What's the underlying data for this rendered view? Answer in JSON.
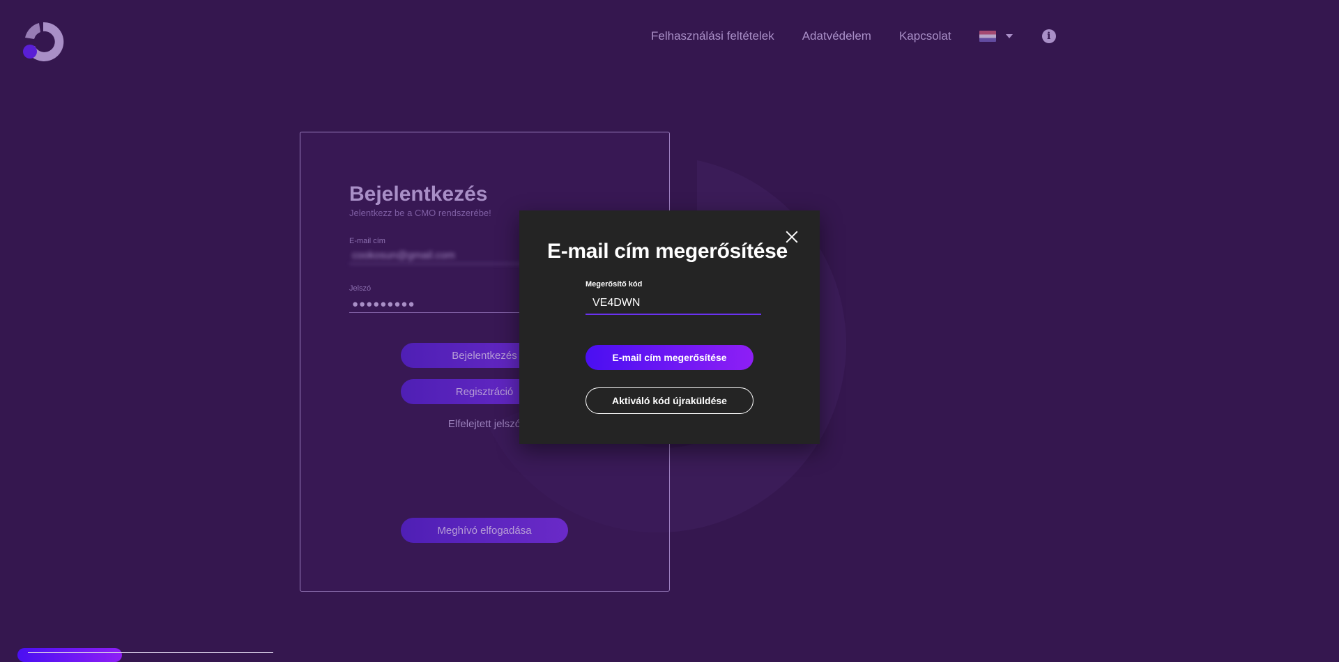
{
  "nav": {
    "links": [
      "Felhasználási feltételek",
      "Adatvédelem",
      "Kapcsolat"
    ],
    "language_icon": "hungarian-flag-icon",
    "info_icon": "info-icon",
    "info_glyph": "i"
  },
  "login": {
    "title": "Bejelentkezés",
    "subtitle": "Jelentkezz be a CMO rendszerébe!",
    "email_label": "E-mail cím",
    "email_value": "cookosun@gmail.com",
    "password_label": "Jelszó",
    "password_value": "●●●●●●●●●",
    "login_button": "Bejelentkezés",
    "register_button": "Regisztráció",
    "forgot_link": "Elfelejtett jelszó",
    "invite_button": "Meghívó elfogadása"
  },
  "modal": {
    "title": "E-mail cím megerősítése",
    "code_label": "Megerősítő kód",
    "code_value": "VE4DWN",
    "confirm_button": "E-mail cím megerősítése",
    "resend_button": "Aktiváló kód újraküldése"
  },
  "colors": {
    "background": "#35174f",
    "accent_start": "#4a0ff2",
    "accent_end": "#8e1ff5",
    "modal_bg": "#242424"
  }
}
